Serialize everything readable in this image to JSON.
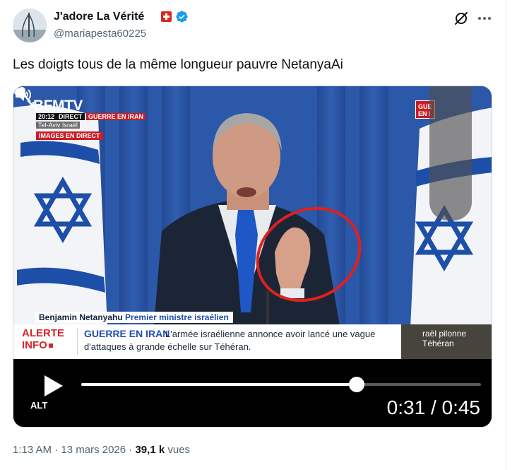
{
  "author": {
    "display_name": "J'adore La Vérité",
    "handle": "@mariapesta60225",
    "flag_icon": "swiss-flag-icon",
    "verified_icon": "verified-badge-icon",
    "verified_color": "#1d9bf0"
  },
  "header_actions": {
    "grok_icon": "grok-icon",
    "more_icon": "more-horizontal-icon"
  },
  "tweet": {
    "text": "Les doigts tous de la même longueur pauvre NetanyaAi"
  },
  "video": {
    "overlay": {
      "channel_logo": "BFMTV",
      "time": "20:12",
      "direct_label": "DIRECT",
      "topic_tag": "GUERRE EN IRAN",
      "location": "Tel-Aviv Israël",
      "live_label": "IMAGES EN DIRECT",
      "corner_tag": "GUE\nEN I",
      "speaker_name": "Benjamin Netanyahu",
      "speaker_role": "Premier ministre israélien",
      "alert_line1": "ALERTE",
      "alert_line2": "INFO",
      "ticker_headline": "GUERRE EN IRAN",
      "ticker_text_line1": "L'armée israélienne annonce avoir lancé une vague",
      "ticker_text_line2": "d'attaques à grande échelle sur Téhéran.",
      "next_clip_line1": "raël pilonne",
      "next_clip_line2": "Téhéran",
      "annotation_color": "#e0201f"
    },
    "controls": {
      "play_icon": "play-icon",
      "mute_icon": "muted-speaker-icon",
      "fullscreen_icon": "fullscreen-icon",
      "alt_label": "ALT",
      "time_current": "0:31",
      "time_separator": "/",
      "time_total": "0:45",
      "progress_fraction": 0.689
    }
  },
  "meta": {
    "time": "1:13 AM",
    "separator": "·",
    "date": "13 mars 2026",
    "views_count": "39,1 k",
    "views_label": "vues"
  }
}
